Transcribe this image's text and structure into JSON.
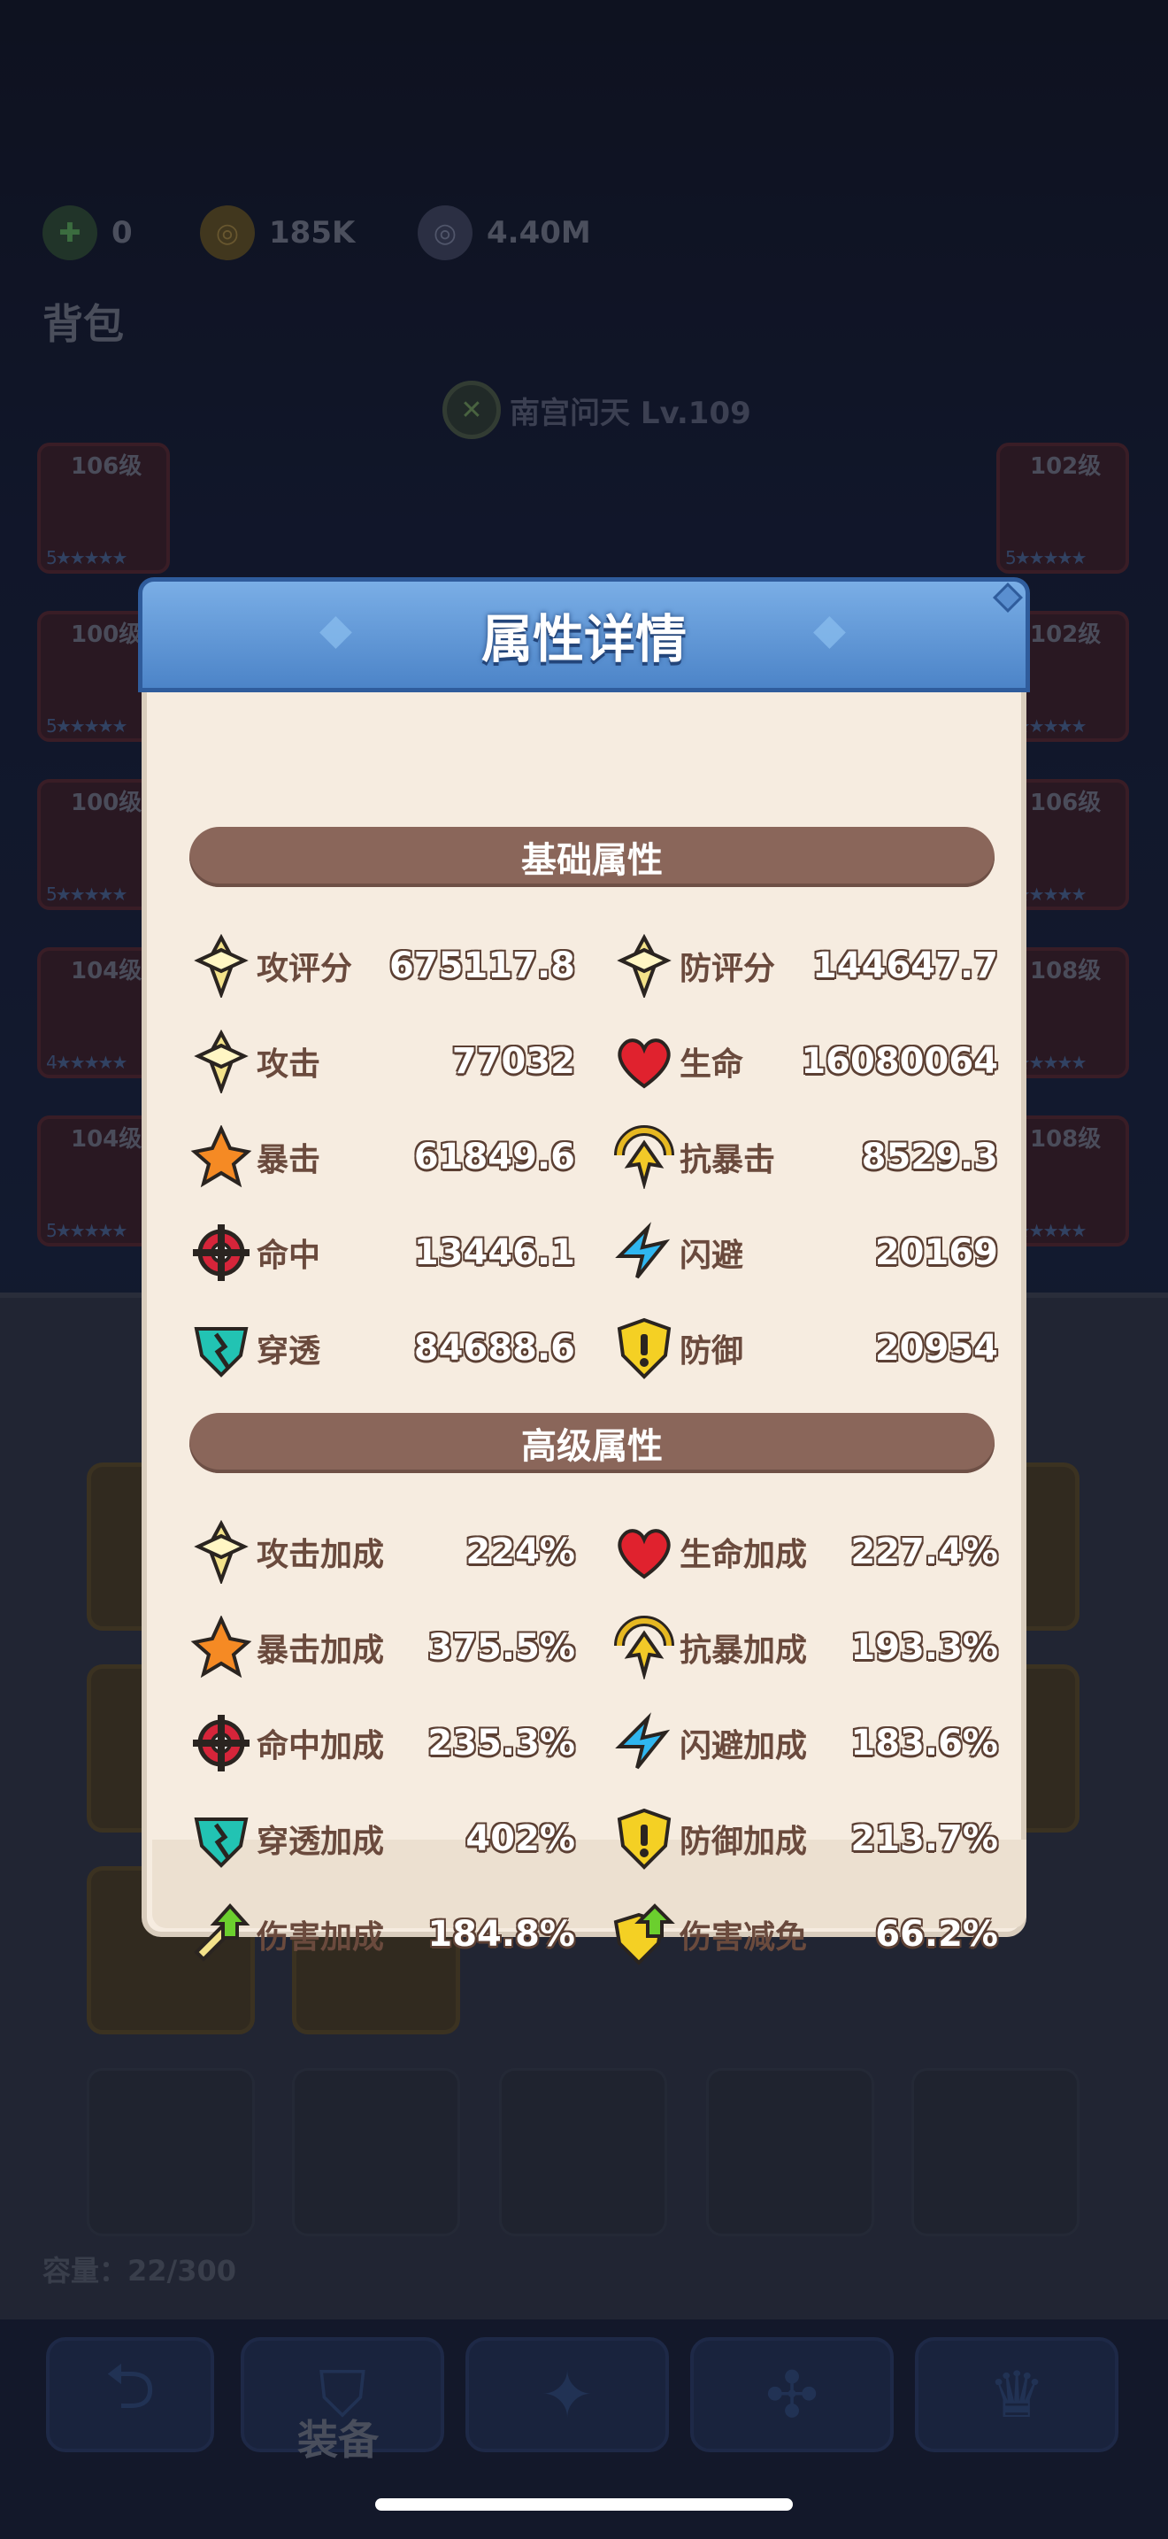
{
  "resources": [
    {
      "icon": "gem-plus-icon",
      "value": "0"
    },
    {
      "icon": "gold-coin-icon",
      "value": "185K"
    },
    {
      "icon": "silver-coin-icon",
      "value": "4.40M"
    }
  ],
  "bag_title": "背包",
  "hero": {
    "name": "南宫问天 Lv.109"
  },
  "left_slots": [
    {
      "level": "106级",
      "stars": "5★★★★★"
    },
    {
      "level": "100级",
      "stars": "5★★★★★"
    },
    {
      "level": "100级",
      "stars": "5★★★★★"
    },
    {
      "level": "104级",
      "stars": "4★★★★★"
    },
    {
      "level": "104级",
      "stars": "5★★★★★"
    }
  ],
  "right_slots": [
    {
      "level": "102级",
      "stars": "5★★★★★"
    },
    {
      "level": "102级",
      "stars": "5★★★★★"
    },
    {
      "level": "106级",
      "stars": "5★★★★★"
    },
    {
      "level": "108级",
      "stars": "2★★★★★"
    },
    {
      "level": "108级",
      "stars": "3★★★★★"
    }
  ],
  "capacity": "容量：22/300",
  "tabs": {
    "active_label": "装备"
  },
  "modal": {
    "title": "属性详情",
    "basic_section": "基础属性",
    "advanced_section": "高级属性",
    "basic": [
      {
        "icon": "attack-rating-icon",
        "name": "攻评分",
        "value": "675117.8"
      },
      {
        "icon": "defense-rating-icon",
        "name": "防评分",
        "value": "144647.7"
      },
      {
        "icon": "attack-icon",
        "name": "攻击",
        "value": "77032"
      },
      {
        "icon": "heart-icon",
        "name": "生命",
        "value": "16080064"
      },
      {
        "icon": "crit-icon",
        "name": "暴击",
        "value": "61849.6"
      },
      {
        "icon": "anti-crit-icon",
        "name": "抗暴击",
        "value": "8529.3"
      },
      {
        "icon": "accuracy-icon",
        "name": "命中",
        "value": "13446.1"
      },
      {
        "icon": "dodge-icon",
        "name": "闪避",
        "value": "20169"
      },
      {
        "icon": "penetration-icon",
        "name": "穿透",
        "value": "84688.6"
      },
      {
        "icon": "defense-icon",
        "name": "防御",
        "value": "20954"
      }
    ],
    "advanced": [
      {
        "icon": "attack-icon",
        "name": "攻击加成",
        "value": "224%"
      },
      {
        "icon": "heart-icon",
        "name": "生命加成",
        "value": "227.4%"
      },
      {
        "icon": "crit-icon",
        "name": "暴击加成",
        "value": "375.5%"
      },
      {
        "icon": "anti-crit-icon",
        "name": "抗暴加成",
        "value": "193.3%"
      },
      {
        "icon": "accuracy-icon",
        "name": "命中加成",
        "value": "235.3%"
      },
      {
        "icon": "dodge-icon",
        "name": "闪避加成",
        "value": "183.6%"
      },
      {
        "icon": "penetration-icon",
        "name": "穿透加成",
        "value": "402%"
      },
      {
        "icon": "defense-icon",
        "name": "防御加成",
        "value": "213.7%"
      },
      {
        "icon": "damage-bonus-icon",
        "name": "伤害加成",
        "value": "184.8%"
      },
      {
        "icon": "damage-reduction-icon",
        "name": "伤害减免",
        "value": "66.2%"
      }
    ]
  }
}
